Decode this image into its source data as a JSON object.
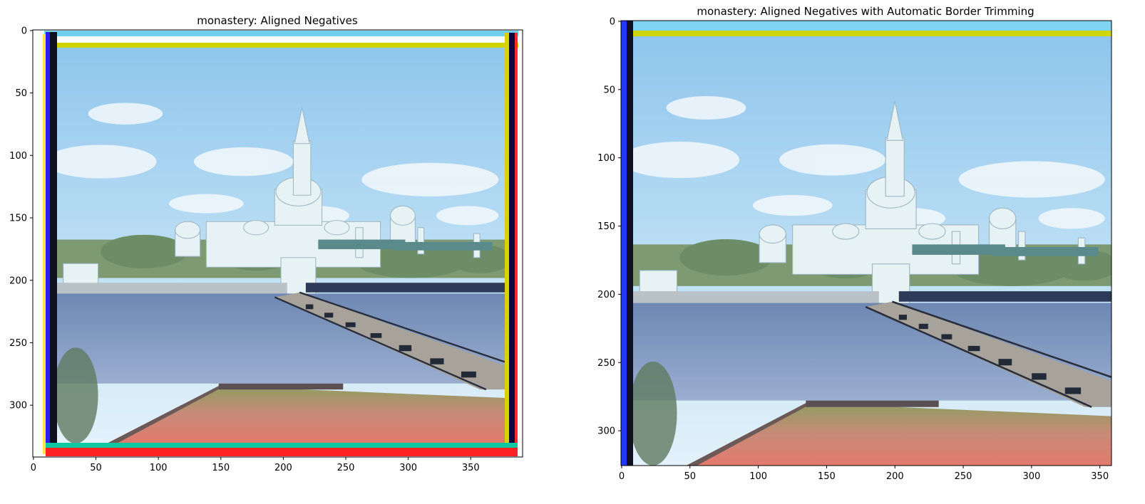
{
  "chart_data": [
    {
      "type": "image",
      "title": "monastery: Aligned Negatives",
      "xlim": [
        -0.5,
        391.5
      ],
      "ylim": [
        341.5,
        -0.5
      ],
      "xticks": [
        0,
        50,
        100,
        150,
        200,
        250,
        300,
        350
      ],
      "yticks": [
        0,
        50,
        100,
        150,
        200,
        250,
        300
      ],
      "image_description": "Color photograph of a white monastery with domes and bell tower on a lake, a long wooden bridge on the right, dirt field in the foreground; with colored misalignment border strips (blue, yellow, red, green)",
      "border_strips": [
        "blue",
        "yellow",
        "magenta",
        "red",
        "cyan"
      ]
    },
    {
      "type": "image",
      "title": "monastery: Aligned Negatives with Automatic Border Trimming",
      "xlim": [
        -0.5,
        358.5
      ],
      "ylim": [
        325.5,
        -0.5
      ],
      "xticks": [
        0,
        50,
        100,
        150,
        200,
        250,
        300,
        350
      ],
      "yticks": [
        0,
        50,
        100,
        150,
        200,
        250,
        300
      ],
      "image_description": "Same monastery photograph, cropped with most colored borders removed; a blue/black strip remains at left and a cyan strip at top",
      "border_strips": [
        "blue",
        "cyan",
        "yellow"
      ]
    }
  ]
}
